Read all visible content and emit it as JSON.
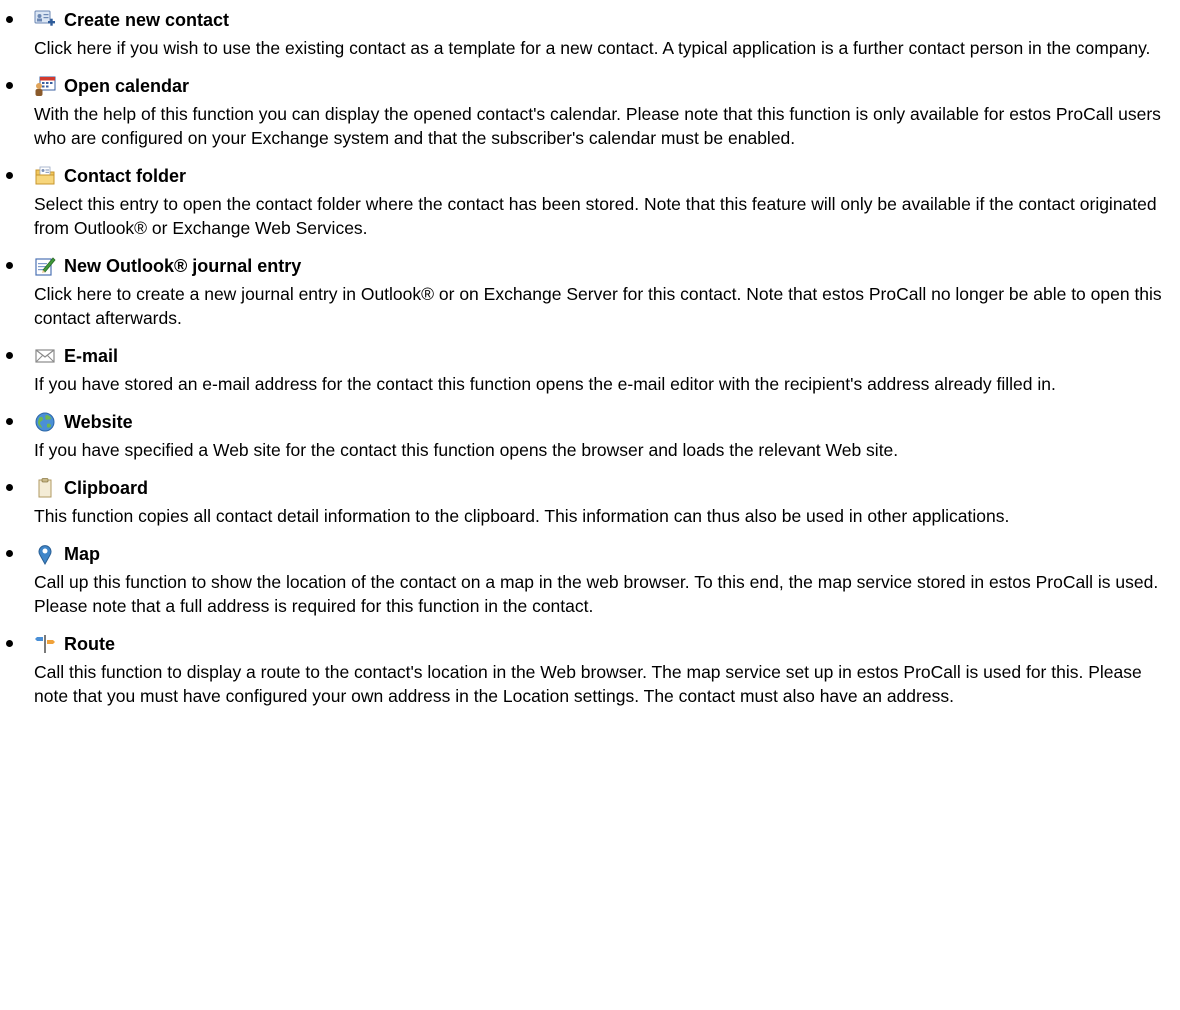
{
  "items": [
    {
      "icon": "contact-card-plus-icon",
      "title": "Create new contact",
      "text": "Click here if you wish to use the existing contact as a template for a new contact. A typical application is a further contact person in the company."
    },
    {
      "icon": "calendar-icon",
      "title": "Open calendar",
      "text": "With the help of this function you can display the opened contact's calendar. Please note that this function is only available for estos ProCall users who are configured on your Exchange system and that the subscriber's calendar must be enabled."
    },
    {
      "icon": "contact-folder-icon",
      "title": "Contact folder",
      "text": "Select this entry to open the contact folder where the contact has been stored. Note that this feature will only be available if the contact originated from Outlook® or Exchange Web Services."
    },
    {
      "icon": "journal-pencil-icon",
      "title": "New Outlook® journal entry",
      "text": "Click here to create a new journal entry in Outlook® or on Exchange Server for this contact. Note that estos ProCall no longer be able to open this contact afterwards."
    },
    {
      "icon": "envelope-icon",
      "title": "E-mail",
      "text": "If you have stored an e-mail address for the contact this function opens the e-mail editor with the recipient's address already filled in."
    },
    {
      "icon": "globe-icon",
      "title": "Website",
      "text": "If you have specified a Web site for the contact this function opens the browser and loads the relevant Web site."
    },
    {
      "icon": "clipboard-icon",
      "title": "Clipboard",
      "text": "This function copies all contact detail information to the clipboard. This information can thus also be used in other applications."
    },
    {
      "icon": "map-pin-icon",
      "title": "Map",
      "text": "Call up this function to show the location of the contact on a map in the web browser. To this end, the map service stored in estos ProCall is used. Please note that a full address is required for this function in the contact."
    },
    {
      "icon": "route-signpost-icon",
      "title": "Route",
      "text": "Call this function to display a route to the contact's location in the Web browser. The map service set up in estos ProCall is used for this. Please note that you must have configured your own address in the Location settings. The contact must also have an address."
    }
  ]
}
